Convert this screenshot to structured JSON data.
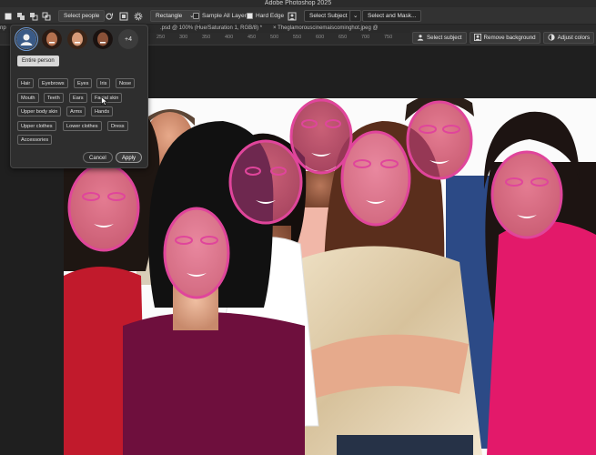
{
  "window": {
    "title": "Adobe Photoshop 2025"
  },
  "options_bar": {
    "select_people_label": "Select people",
    "shape_select": "Rectangle",
    "sample_all_layers_label": "Sample All Layers",
    "sample_all_layers_checked": false,
    "hard_edge_label": "Hard Edge",
    "hard_edge_checked": true,
    "select_subject_label": "Select Subject",
    "select_and_mask_label": "Select and Mask..."
  },
  "tabs": [
    {
      "label": "np"
    },
    {
      "label": ".psd @ 100% (Hue/Saturation 1, RGB/8) *"
    },
    {
      "label": "× Theglamorouscinemaiscominghot.jpeg @"
    }
  ],
  "ruler": {
    "ticks": [
      "250",
      "300",
      "350",
      "400",
      "450",
      "500",
      "550",
      "600",
      "650",
      "700",
      "750",
      "800",
      "850",
      "900",
      "950",
      "1000",
      "1050",
      "1100",
      "1150",
      "1200",
      "1250",
      "1300",
      "1350",
      "1400",
      "1450",
      "1500",
      "1550",
      "1600"
    ]
  },
  "context_toolbar": {
    "select_subject": "Select subject",
    "remove_background": "Remove background",
    "adjust_colors": "Adjust colors"
  },
  "people_panel": {
    "more_count": "+4",
    "entire_person": "Entire person",
    "parts": [
      "Hair",
      "Eyebrows",
      "Eyes",
      "Iris",
      "Nose",
      "Mouth",
      "Teeth",
      "Ears",
      "Facial skin",
      "Upper body skin",
      "Arms",
      "Hands",
      "Upper clothes",
      "Lower clothes",
      "Dress",
      "Accessories"
    ],
    "selected_part": "Facial skin",
    "cancel": "Cancel",
    "apply": "Apply"
  },
  "colors": {
    "accent_selection": "#e0459b",
    "panel_bg": "#2e2e2e",
    "app_bg": "#1e1e1e"
  }
}
